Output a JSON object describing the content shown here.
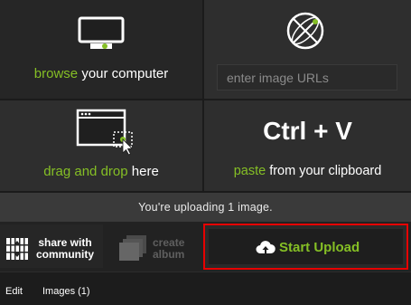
{
  "browse": {
    "highlight": "browse",
    "rest": " your computer",
    "icon": "monitor-icon"
  },
  "url": {
    "placeholder": "enter image URLs",
    "icon": "globe-icon"
  },
  "drag": {
    "highlight": "drag and drop",
    "rest": " here",
    "icon": "window-drag-icon"
  },
  "paste": {
    "keys": "Ctrl + V",
    "highlight": "paste",
    "rest": " from your clipboard"
  },
  "status": {
    "text": "You're uploading 1 image."
  },
  "actions": {
    "share_label": "share with community",
    "share_line1": "share with",
    "share_line2": "community",
    "album_line1": "create",
    "album_line2": "album",
    "upload_label": "Start Upload"
  },
  "menu": {
    "edit": "Edit",
    "images": "Images (1)"
  },
  "colors": {
    "accent": "#85bf25",
    "highlight_border": "#e60000",
    "panel": "#2e2e2e"
  }
}
